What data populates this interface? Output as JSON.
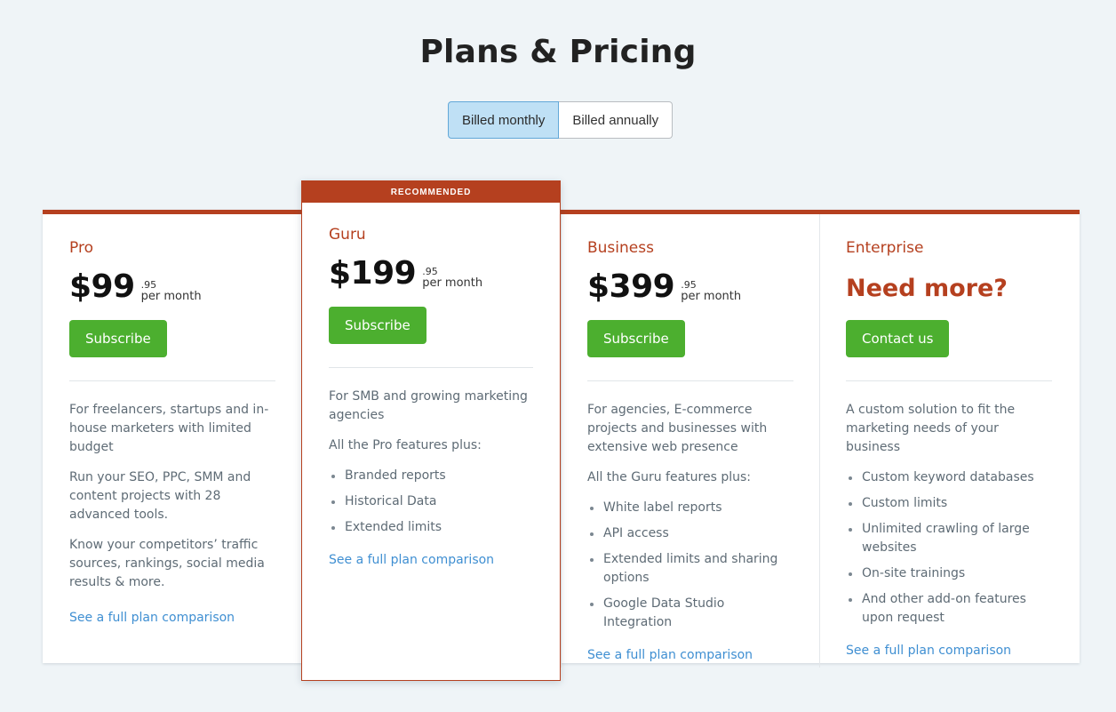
{
  "header": {
    "title": "Plans & Pricing",
    "billing_toggle": [
      {
        "label": "Billed monthly",
        "active": true
      },
      {
        "label": "Billed annually",
        "active": false
      }
    ]
  },
  "colors": {
    "page_background": "#eff4f7",
    "accent_rust": "#b5401f",
    "cta_green": "#4caf2f",
    "link_blue": "#3f8fd2",
    "toggle_active_fill": "#bfe0f5",
    "body_text": "#5e6b75"
  },
  "ribbon_label": "RECOMMENDED",
  "plans": [
    {
      "name": "Pro",
      "price_main": "$99",
      "price_cents": ".95",
      "price_period": "per month",
      "cta_label": "Subscribe",
      "paragraphs": [
        "For freelancers, startups and in-house marketers with limited budget",
        "Run your SEO, PPC, SMM and content projects with 28 advanced tools.",
        "Know your competitors’ traffic sources, rankings, social media results & more."
      ],
      "features": [],
      "link_label": "See a full plan comparison"
    },
    {
      "name": "Guru",
      "price_main": "$199",
      "price_cents": ".95",
      "price_period": "per month",
      "cta_label": "Subscribe",
      "paragraphs": [
        "For SMB and growing marketing agencies",
        "All the Pro features plus:"
      ],
      "features": [
        "Branded reports",
        "Historical Data",
        "Extended limits"
      ],
      "link_label": "See a full plan comparison"
    },
    {
      "name": "Business",
      "price_main": "$399",
      "price_cents": ".95",
      "price_period": "per month",
      "cta_label": "Subscribe",
      "paragraphs": [
        "For agencies, E-commerce projects and businesses with extensive web presence",
        "All the Guru features plus:"
      ],
      "features": [
        "White label reports",
        "API access",
        "Extended limits and sharing options",
        "Google Data Studio Integration"
      ],
      "link_label": "See a full plan comparison"
    },
    {
      "name": "Enterprise",
      "headline": "Need more?",
      "cta_label": "Contact us",
      "paragraphs": [
        "A custom solution to fit the marketing needs of your business"
      ],
      "features": [
        "Custom keyword databases",
        "Custom limits",
        "Unlimited crawling of large websites",
        "On-site trainings",
        "And other add-on features upon request"
      ],
      "link_label": "See a full plan comparison"
    }
  ]
}
